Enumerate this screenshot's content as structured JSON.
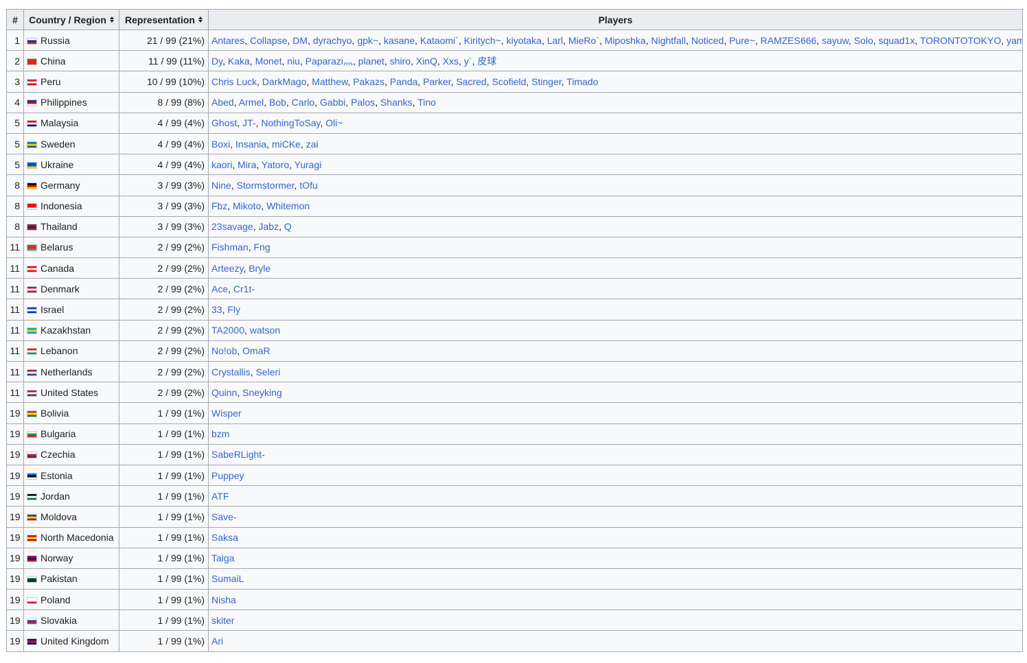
{
  "table": {
    "headers": {
      "rank": "#",
      "country": "Country / Region",
      "representation": "Representation",
      "players": "Players"
    },
    "rows": [
      {
        "rank": "1",
        "country": "Russia",
        "flag": [
          "#ffffff",
          "#0039a6",
          "#d52b1e"
        ],
        "rep": "21 / 99 (21%)",
        "players": [
          "Antares",
          "Collapse",
          "DM",
          "dyrachyo",
          "gpk~",
          "kasane",
          "Kataomi`",
          "Kiritych~",
          "kiyotaka",
          "Larl",
          "MieRo`",
          "Miposhka",
          "Nightfall",
          "Noticed",
          "Pure~",
          "RAMZES666",
          "sayuw",
          "Solo",
          "squad1x",
          "TORONTOTOKYO",
          "yamich"
        ]
      },
      {
        "rank": "2",
        "country": "China",
        "flag": [
          "#de2910",
          "#de2910",
          "#de2910"
        ],
        "rep": "11 / 99 (11%)",
        "players": [
          "Dy",
          "Kaka",
          "Monet",
          "niu",
          "Paparazi灬",
          "planet",
          "shiro",
          "XinQ",
          "Xxs",
          "y`",
          "皮球"
        ]
      },
      {
        "rank": "3",
        "country": "Peru",
        "flag": [
          "#d91023",
          "#ffffff",
          "#d91023"
        ],
        "rep": "10 / 99 (10%)",
        "players": [
          "Chris Luck",
          "DarkMago",
          "Matthew",
          "Pakazs",
          "Panda",
          "Parker",
          "Sacred",
          "Scofield",
          "Stinger",
          "Timado"
        ]
      },
      {
        "rank": "4",
        "country": "Philippines",
        "flag": [
          "#0038a8",
          "#ce1126",
          "#ffffff"
        ],
        "rep": "8 / 99 (8%)",
        "players": [
          "Abed",
          "Armel",
          "Bob",
          "Carlo",
          "Gabbi",
          "Palos",
          "Shanks",
          "Tino"
        ]
      },
      {
        "rank": "5",
        "country": "Malaysia",
        "flag": [
          "#cc0001",
          "#ffffff",
          "#010066"
        ],
        "rep": "4 / 99 (4%)",
        "players": [
          "Ghost",
          "JT-",
          "NothingToSay",
          "Oli~"
        ]
      },
      {
        "rank": "5",
        "country": "Sweden",
        "flag": [
          "#006aa7",
          "#fecc00",
          "#006aa7"
        ],
        "rep": "4 / 99 (4%)",
        "players": [
          "Boxi",
          "Insania",
          "miCKe",
          "zai"
        ]
      },
      {
        "rank": "5",
        "country": "Ukraine",
        "flag": [
          "#0057b7",
          "#0057b7",
          "#ffd700"
        ],
        "rep": "4 / 99 (4%)",
        "players": [
          "kaori",
          "Mira",
          "Yatoro",
          "Yuragi"
        ]
      },
      {
        "rank": "8",
        "country": "Germany",
        "flag": [
          "#000000",
          "#dd0000",
          "#ffce00"
        ],
        "rep": "3 / 99 (3%)",
        "players": [
          "Nine",
          "Stormstormer",
          "tOfu"
        ]
      },
      {
        "rank": "8",
        "country": "Indonesia",
        "flag": [
          "#ff0000",
          "#ff0000",
          "#ffffff"
        ],
        "rep": "3 / 99 (3%)",
        "players": [
          "Fbz",
          "Mikoto",
          "Whitemon"
        ]
      },
      {
        "rank": "8",
        "country": "Thailand",
        "flag": [
          "#a51931",
          "#2d2a4a",
          "#a51931"
        ],
        "rep": "3 / 99 (3%)",
        "players": [
          "23savage",
          "Jabz",
          "Q"
        ]
      },
      {
        "rank": "11",
        "country": "Belarus",
        "flag": [
          "#c8313e",
          "#c8313e",
          "#4aa657"
        ],
        "rep": "2 / 99 (2%)",
        "players": [
          "Fishman",
          "Fng"
        ]
      },
      {
        "rank": "11",
        "country": "Canada",
        "flag": [
          "#ff0000",
          "#ffffff",
          "#ff0000"
        ],
        "rep": "2 / 99 (2%)",
        "players": [
          "Arteezy",
          "Bryle"
        ]
      },
      {
        "rank": "11",
        "country": "Denmark",
        "flag": [
          "#c60c30",
          "#ffffff",
          "#c60c30"
        ],
        "rep": "2 / 99 (2%)",
        "players": [
          "Ace",
          "Cr1t-"
        ]
      },
      {
        "rank": "11",
        "country": "Israel",
        "flag": [
          "#0038b8",
          "#ffffff",
          "#0038b8"
        ],
        "rep": "2 / 99 (2%)",
        "players": [
          "33",
          "Fly"
        ]
      },
      {
        "rank": "11",
        "country": "Kazakhstan",
        "flag": [
          "#00afca",
          "#fec50c",
          "#00afca"
        ],
        "rep": "2 / 99 (2%)",
        "players": [
          "TA2000",
          "watson"
        ]
      },
      {
        "rank": "11",
        "country": "Lebanon",
        "flag": [
          "#ed1c24",
          "#ffffff",
          "#00a651"
        ],
        "rep": "2 / 99 (2%)",
        "players": [
          "No!ob",
          "OmaR"
        ]
      },
      {
        "rank": "11",
        "country": "Netherlands",
        "flag": [
          "#ae1c28",
          "#ffffff",
          "#21468b"
        ],
        "rep": "2 / 99 (2%)",
        "players": [
          "Crystallis",
          "Seleri"
        ]
      },
      {
        "rank": "11",
        "country": "United States",
        "flag": [
          "#b22234",
          "#ffffff",
          "#3c3b6e"
        ],
        "rep": "2 / 99 (2%)",
        "players": [
          "Quinn",
          "Sneyking"
        ]
      },
      {
        "rank": "19",
        "country": "Bolivia",
        "flag": [
          "#d52b1e",
          "#f9e300",
          "#007934"
        ],
        "rep": "1 / 99 (1%)",
        "players": [
          "Wisper"
        ]
      },
      {
        "rank": "19",
        "country": "Bulgaria",
        "flag": [
          "#ffffff",
          "#00966e",
          "#d62612"
        ],
        "rep": "1 / 99 (1%)",
        "players": [
          "bzm"
        ]
      },
      {
        "rank": "19",
        "country": "Czechia",
        "flag": [
          "#ffffff",
          "#d7141a",
          "#11457e"
        ],
        "rep": "1 / 99 (1%)",
        "players": [
          "SabeRLight-"
        ]
      },
      {
        "rank": "19",
        "country": "Estonia",
        "flag": [
          "#0072ce",
          "#000000",
          "#ffffff"
        ],
        "rep": "1 / 99 (1%)",
        "players": [
          "Puppey"
        ]
      },
      {
        "rank": "19",
        "country": "Jordan",
        "flag": [
          "#000000",
          "#ffffff",
          "#007a3d"
        ],
        "rep": "1 / 99 (1%)",
        "players": [
          "ATF"
        ]
      },
      {
        "rank": "19",
        "country": "Moldova",
        "flag": [
          "#0046ae",
          "#ffd200",
          "#cc092f"
        ],
        "rep": "1 / 99 (1%)",
        "players": [
          "Save-"
        ]
      },
      {
        "rank": "19",
        "country": "North Macedonia",
        "flag": [
          "#d20000",
          "#ffe600",
          "#d20000"
        ],
        "rep": "1 / 99 (1%)",
        "players": [
          "Saksa"
        ]
      },
      {
        "rank": "19",
        "country": "Norway",
        "flag": [
          "#ba0c2f",
          "#00205b",
          "#ba0c2f"
        ],
        "rep": "1 / 99 (1%)",
        "players": [
          "Taiga"
        ]
      },
      {
        "rank": "19",
        "country": "Pakistan",
        "flag": [
          "#ffffff",
          "#01411c",
          "#01411c"
        ],
        "rep": "1 / 99 (1%)",
        "players": [
          "SumaiL"
        ]
      },
      {
        "rank": "19",
        "country": "Poland",
        "flag": [
          "#ffffff",
          "#ffffff",
          "#dc143c"
        ],
        "rep": "1 / 99 (1%)",
        "players": [
          "Nisha"
        ]
      },
      {
        "rank": "19",
        "country": "Slovakia",
        "flag": [
          "#ffffff",
          "#0b4ea2",
          "#ee1c25"
        ],
        "rep": "1 / 99 (1%)",
        "players": [
          "skiter"
        ]
      },
      {
        "rank": "19",
        "country": "United Kingdom",
        "flag": [
          "#012169",
          "#c8102e",
          "#012169"
        ],
        "rep": "1 / 99 (1%)",
        "players": [
          "Ari"
        ]
      }
    ]
  }
}
